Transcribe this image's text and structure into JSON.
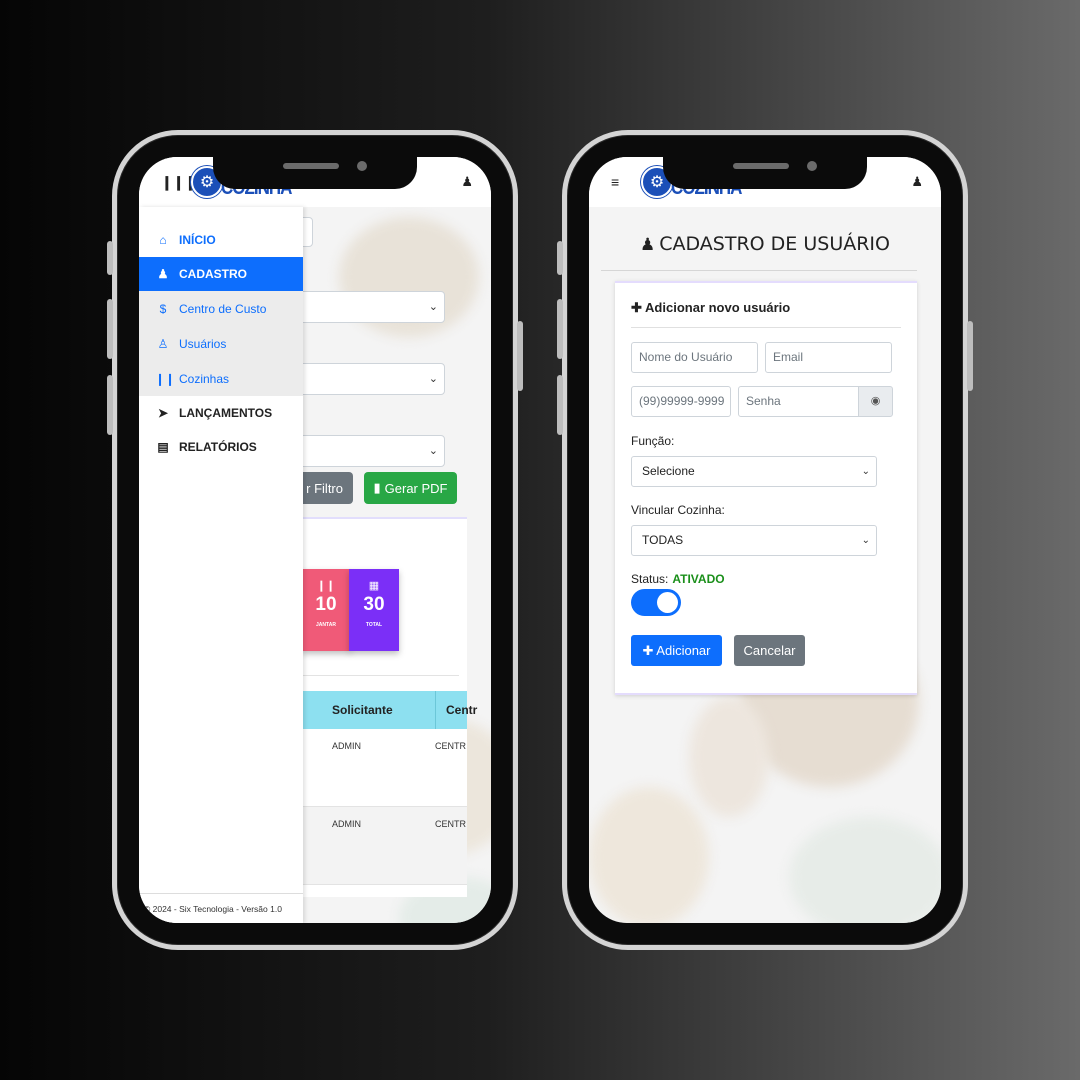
{
  "brand": {
    "name": "COZINHA",
    "color": "#1b4fb8"
  },
  "colors": {
    "primary": "#0d6efd",
    "secondary": "#6c757d",
    "success": "#28a745",
    "stat_pink": "#f05a78",
    "stat_purple": "#7b2ff7",
    "table_header": "#8de0f0",
    "status_on": "#1a8f1a"
  },
  "left_phone": {
    "sidebar": {
      "items": [
        {
          "label": "INÍCIO",
          "icon": "home-icon"
        },
        {
          "label": "CADASTRO",
          "icon": "user-cog-icon"
        },
        {
          "label": "Centro de Custo",
          "icon": "dollar-icon"
        },
        {
          "label": "Usuários",
          "icon": "users-icon"
        },
        {
          "label": "Cozinhas",
          "icon": "utensils-icon"
        },
        {
          "label": "LANÇAMENTOS",
          "icon": "rocket-icon"
        },
        {
          "label": "RELATÓRIOS",
          "icon": "chart-icon"
        }
      ],
      "footer": "© 2024 - Six Tecnologia - Versão 1.0"
    },
    "dashboard": {
      "filter_button_label": "r Filtro",
      "pdf_button_label": "Gerar PDF",
      "stats": [
        {
          "value": "10",
          "label": "JANTAR"
        },
        {
          "value": "30",
          "label": "TOTAL"
        }
      ],
      "table": {
        "columns": [
          "Solicitante",
          "Centr"
        ],
        "rows": [
          {
            "solicitante": "ADMIN",
            "centro": "CENTR"
          },
          {
            "solicitante": "ADMIN",
            "centro": "CENTR"
          }
        ]
      }
    }
  },
  "right_phone": {
    "page_title": "CADASTRO DE USUÁRIO",
    "form": {
      "header": "Adicionar novo usuário",
      "name_placeholder": "Nome do Usuário",
      "email_placeholder": "Email",
      "phone_placeholder": "(99)99999-9999",
      "password_placeholder": "Senha",
      "role_label": "Função:",
      "role_value": "Selecione",
      "kitchen_label": "Vincular Cozinha:",
      "kitchen_value": "TODAS",
      "status_label": "Status:",
      "status_value": "ATIVADO",
      "status_on": true,
      "add_button": "Adicionar",
      "cancel_button": "Cancelar"
    }
  }
}
